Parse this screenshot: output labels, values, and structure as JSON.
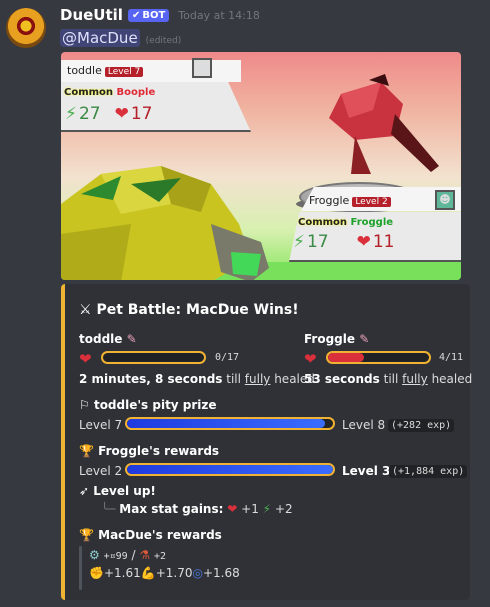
{
  "message": {
    "username": "DueUtil",
    "bot_badge": "BOT",
    "timestamp": "Today at 14:18",
    "mention": "@MacDue",
    "edited": "(edited)"
  },
  "battle_image": {
    "player1": {
      "name": "toddle",
      "level": "Level 7",
      "rarity": "Common",
      "species": "Boople",
      "attack": "27",
      "hp": "17"
    },
    "player2": {
      "name": "Froggle",
      "level": "Level 2",
      "rarity": "Common",
      "species": "Froggle",
      "attack": "17",
      "hp": "11"
    }
  },
  "embed": {
    "title": "Pet Battle: MacDue Wins!",
    "accent_color": "#f0b232",
    "pet1": {
      "name": "toddle",
      "hp_text": "0/17",
      "hp_fraction": 0.0,
      "heal_bold": "2 minutes, 8 seconds",
      "heal_mid": " till ",
      "heal_u": "fully",
      "heal_end": " healed"
    },
    "pet2": {
      "name": "Froggle",
      "hp_text": "4/11",
      "hp_fraction": 0.36,
      "heal_bold": "53 seconds",
      "heal_mid": " till ",
      "heal_u": "fully",
      "heal_end": " healed"
    },
    "pity": {
      "title": "toddle's pity prize",
      "level_from": "Level 7",
      "level_to": "Level 8",
      "exp": "(+282 exp)",
      "fraction": 0.96
    },
    "rewards": {
      "title": "Froggle's rewards",
      "level_from": "Level 2",
      "level_to": "Level 3",
      "exp": "(+1,884 exp)",
      "fraction": 1.0
    },
    "levelup": {
      "title": "Level up!",
      "max_label": "Max stat gains:",
      "hp_gain": "+1",
      "atk_gain": "+2"
    },
    "owner_rewards": {
      "title": "MacDue's rewards",
      "item1": "+¤99",
      "item2": "+2",
      "stat1": "+1.61",
      "stat2": "+1.70",
      "stat3": "+1.68"
    }
  }
}
